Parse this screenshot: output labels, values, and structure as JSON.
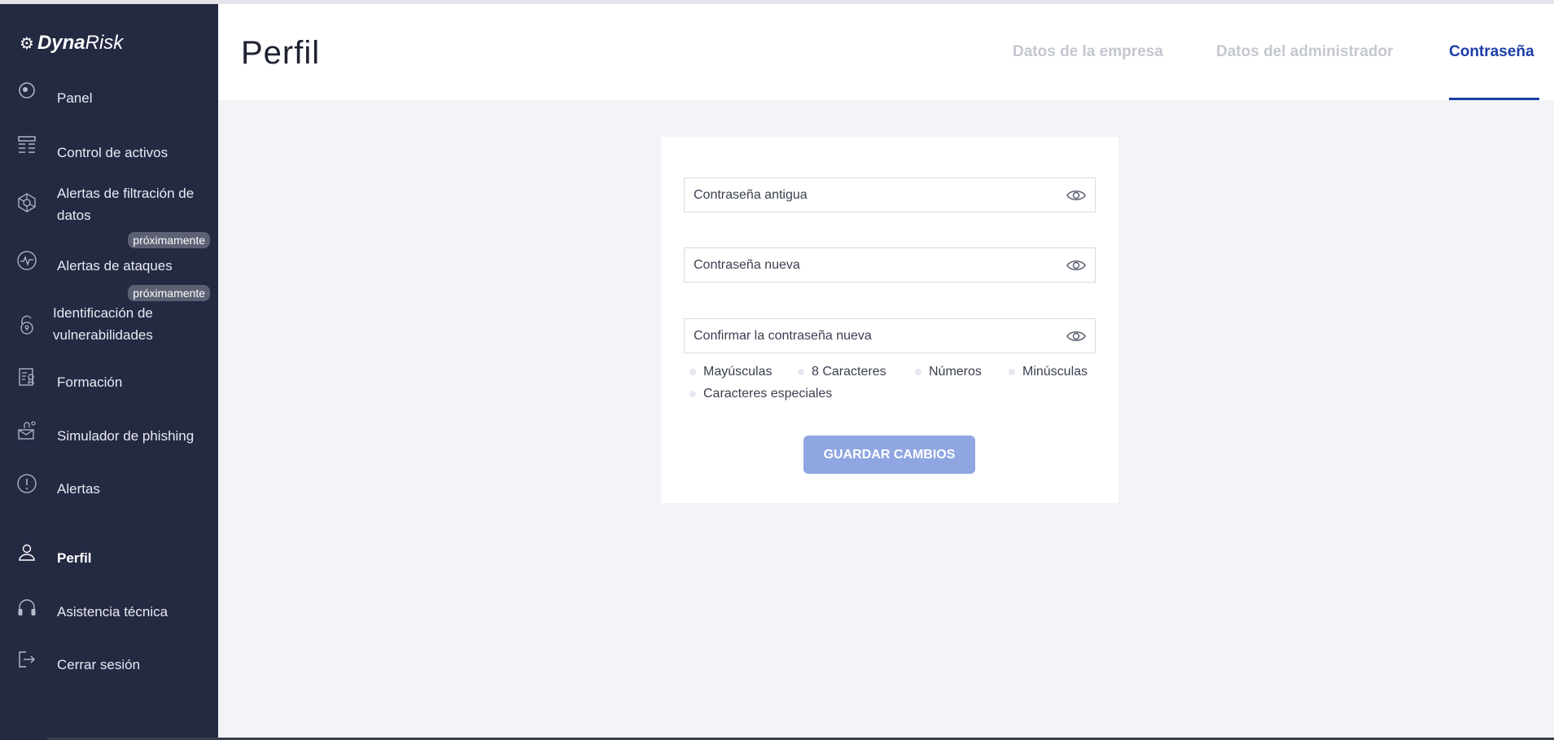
{
  "brand": {
    "name_bold": "Dyna",
    "name_light": "Risk",
    "icon": "gear-logo-icon"
  },
  "sidebar": {
    "items": [
      {
        "label": "Panel",
        "icon": "panel-icon"
      },
      {
        "label": "Control de activos",
        "icon": "asset-control-icon"
      },
      {
        "label": "Alertas de filtración de datos",
        "icon": "data-leak-icon"
      },
      {
        "label": "Alertas de ataques",
        "icon": "pulse-icon",
        "badge": "próximamente"
      },
      {
        "label": "Identificación de vulnerabilidades",
        "icon": "lock-icon",
        "badge": "próximamente"
      },
      {
        "label": "Formación",
        "icon": "training-icon"
      },
      {
        "label": "Simulador de phishing",
        "icon": "phishing-icon"
      },
      {
        "label": "Alertas",
        "icon": "alert-icon"
      },
      {
        "label": "Perfil",
        "icon": "user-icon",
        "active": true
      },
      {
        "label": "Asistencia técnica",
        "icon": "headset-icon"
      },
      {
        "label": "Cerrar sesión",
        "icon": "logout-icon"
      }
    ]
  },
  "header": {
    "title": "Perfil",
    "tabs": [
      {
        "label": "Datos de la empresa"
      },
      {
        "label": "Datos del administrador"
      },
      {
        "label": "Contraseña",
        "active": true
      }
    ]
  },
  "form": {
    "old_password": {
      "placeholder": "Contraseña antigua",
      "value": ""
    },
    "new_password": {
      "placeholder": "Contraseña nueva",
      "value": ""
    },
    "confirm_password": {
      "placeholder": "Confirmar la contraseña nueva",
      "value": ""
    },
    "requirements": [
      "Mayúsculas",
      "8 Caracteres",
      "Números",
      "Minúsculas",
      "Caracteres especiales"
    ],
    "save_label": "GUARDAR CAMBIOS"
  },
  "colors": {
    "sidebar_bg": "#252a43",
    "accent": "#1d3ea8",
    "button": "#8fa6e2",
    "content_bg": "#f3f4f7"
  }
}
